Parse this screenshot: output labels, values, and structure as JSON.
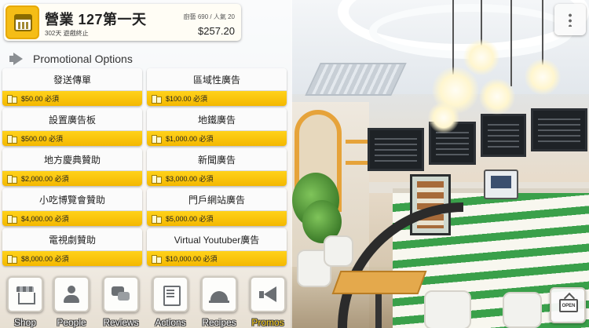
{
  "hud": {
    "title": "營業 127第一天",
    "subtitle": "302天 遊戲終止",
    "stats": "廚藝 690 / 人氣 20",
    "money": "$257.20"
  },
  "section": {
    "title": "Promotional Options"
  },
  "options": [
    {
      "name": "發送傳單",
      "cost": "$50.00 必須"
    },
    {
      "name": "區域性廣告",
      "cost": "$100.00 必須"
    },
    {
      "name": "設置廣告板",
      "cost": "$500.00 必須"
    },
    {
      "name": "地鐵廣告",
      "cost": "$1,000.00 必須"
    },
    {
      "name": "地方慶典贊助",
      "cost": "$2,000.00 必須"
    },
    {
      "name": "新聞廣告",
      "cost": "$3,000.00 必須"
    },
    {
      "name": "小吃博覽會贊助",
      "cost": "$4,000.00 必須"
    },
    {
      "name": "門戶網站廣告",
      "cost": "$5,000.00 必須"
    },
    {
      "name": "電視劇贊助",
      "cost": "$8,000.00 必須"
    },
    {
      "name": "Virtual Youtuber廣告",
      "cost": "$10,000.00 必須"
    }
  ],
  "nav": [
    {
      "label": "Shop",
      "icon": "shop-icon"
    },
    {
      "label": "People",
      "icon": "person-icon"
    },
    {
      "label": "Reviews",
      "icon": "chat-bubbles-icon"
    },
    {
      "label": "Actions",
      "icon": "notebook-icon"
    },
    {
      "label": "Recipes",
      "icon": "cloche-icon"
    },
    {
      "label": "Promos",
      "icon": "megaphone-icon",
      "active": true
    }
  ],
  "open_sign": {
    "text": "OPEN"
  },
  "colors": {
    "accent": "#ffd21b",
    "accent_dark": "#f4b800",
    "panel": "#ffffff",
    "active_label": "#ffd21b"
  }
}
